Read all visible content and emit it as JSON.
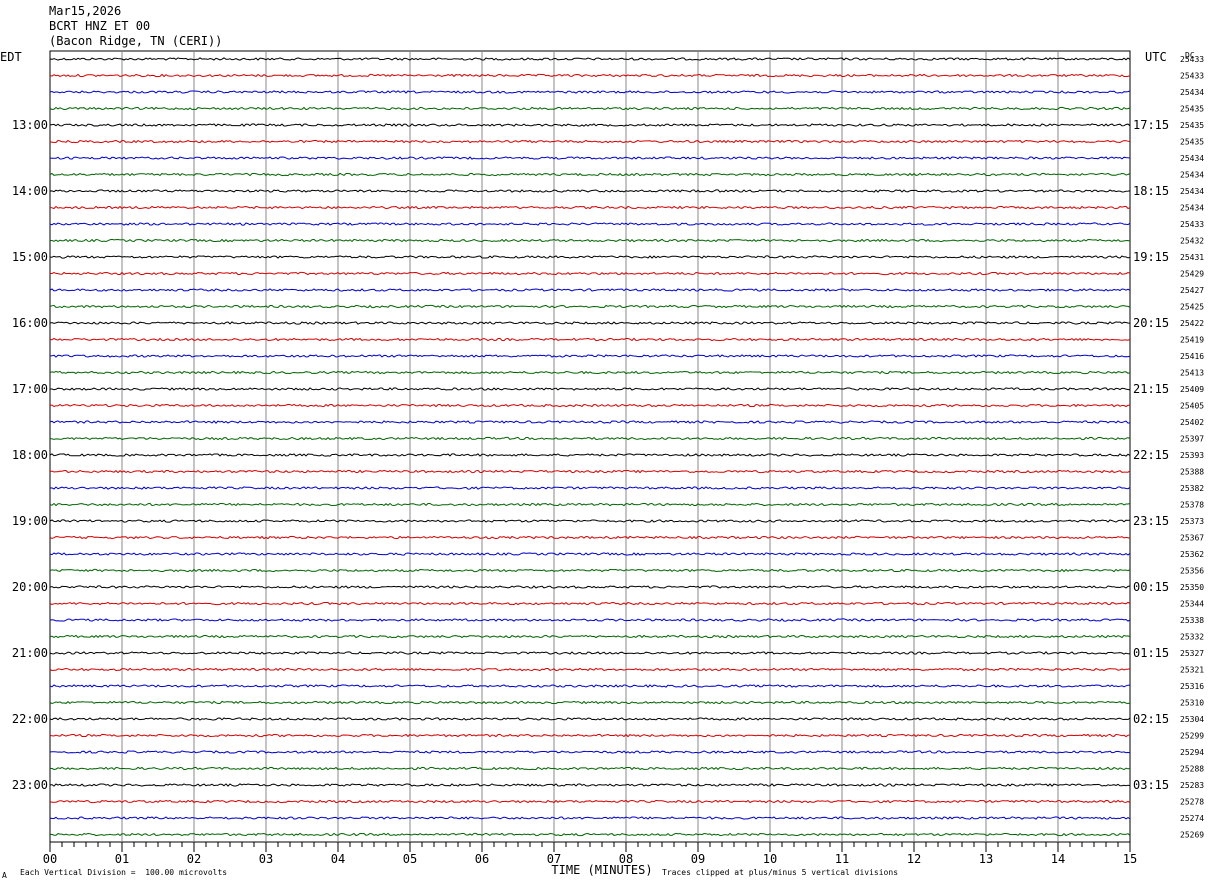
{
  "header": {
    "date": "Mar15,2026",
    "station": "BCRT HNZ ET 00",
    "location": "(Bacon Ridge, TN (CERI))"
  },
  "chart_data": {
    "type": "helicorder",
    "left_axis_label": "EDT",
    "right_axis_label": "UTC",
    "dc_label": "DC",
    "xlabel": "TIME (MINUTES)",
    "x_ticks": [
      "00",
      "01",
      "02",
      "03",
      "04",
      "05",
      "06",
      "07",
      "08",
      "09",
      "10",
      "11",
      "12",
      "13",
      "14",
      "15"
    ],
    "xlim": [
      0,
      15
    ],
    "trace_colors": [
      "#000000",
      "#d40000",
      "#0000c8",
      "#006400"
    ],
    "left_hour_labels": [
      "13:00",
      "14:00",
      "15:00",
      "16:00",
      "17:00",
      "18:00",
      "19:00",
      "20:00",
      "21:00",
      "22:00",
      "23:00"
    ],
    "right_hour_labels": [
      "17:15",
      "18:15",
      "19:15",
      "20:15",
      "21:15",
      "22:15",
      "23:15",
      "00:15",
      "01:15",
      "02:15",
      "03:15"
    ],
    "dc_values": [
      "25433",
      "25433",
      "25434",
      "25435",
      "25435",
      "25435",
      "25434",
      "25434",
      "25434",
      "25434",
      "25433",
      "25432",
      "25431",
      "25429",
      "25427",
      "25425",
      "25422",
      "25419",
      "25416",
      "25413",
      "25409",
      "25405",
      "25402",
      "25397",
      "25393",
      "25388",
      "25382",
      "25378",
      "25373",
      "25367",
      "25362",
      "25356",
      "25350",
      "25344",
      "25338",
      "25332",
      "25327",
      "25321",
      "25316",
      "25310",
      "25304",
      "25299",
      "25294",
      "25288",
      "25283",
      "25278",
      "25274",
      "25269"
    ]
  },
  "footer": {
    "scale_note": "Each Vertical Division =  100.00 microvolts",
    "clip_note": "Traces clipped at plus/minus 5 vertical divisions",
    "corner_mark": "A"
  }
}
